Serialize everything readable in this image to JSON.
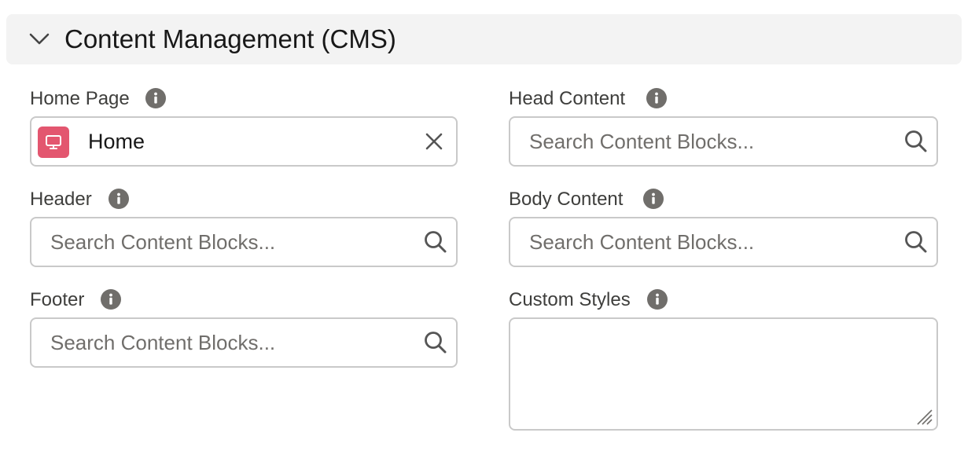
{
  "section": {
    "title": "Content Management (CMS)",
    "toggle_icon": "chevron-down-icon"
  },
  "fields": {
    "home_page": {
      "label": "Home Page",
      "value": "Home",
      "value_icon": "desktop-icon",
      "clear_icon": "close-icon"
    },
    "head_content": {
      "label": "Head Content",
      "placeholder": "Search Content Blocks..."
    },
    "header": {
      "label": "Header",
      "placeholder": "Search Content Blocks..."
    },
    "body_content": {
      "label": "Body Content",
      "placeholder": "Search Content Blocks..."
    },
    "footer": {
      "label": "Footer",
      "placeholder": "Search Content Blocks..."
    },
    "custom_styles": {
      "label": "Custom Styles",
      "value": ""
    }
  },
  "icons": {
    "info": "info-icon",
    "search": "search-icon"
  },
  "colors": {
    "header_bg": "#f3f3f3",
    "home_badge": "#e3566f",
    "border": "#c9c9c9",
    "placeholder": "#706e6b",
    "icon_gray": "#706e6b"
  }
}
